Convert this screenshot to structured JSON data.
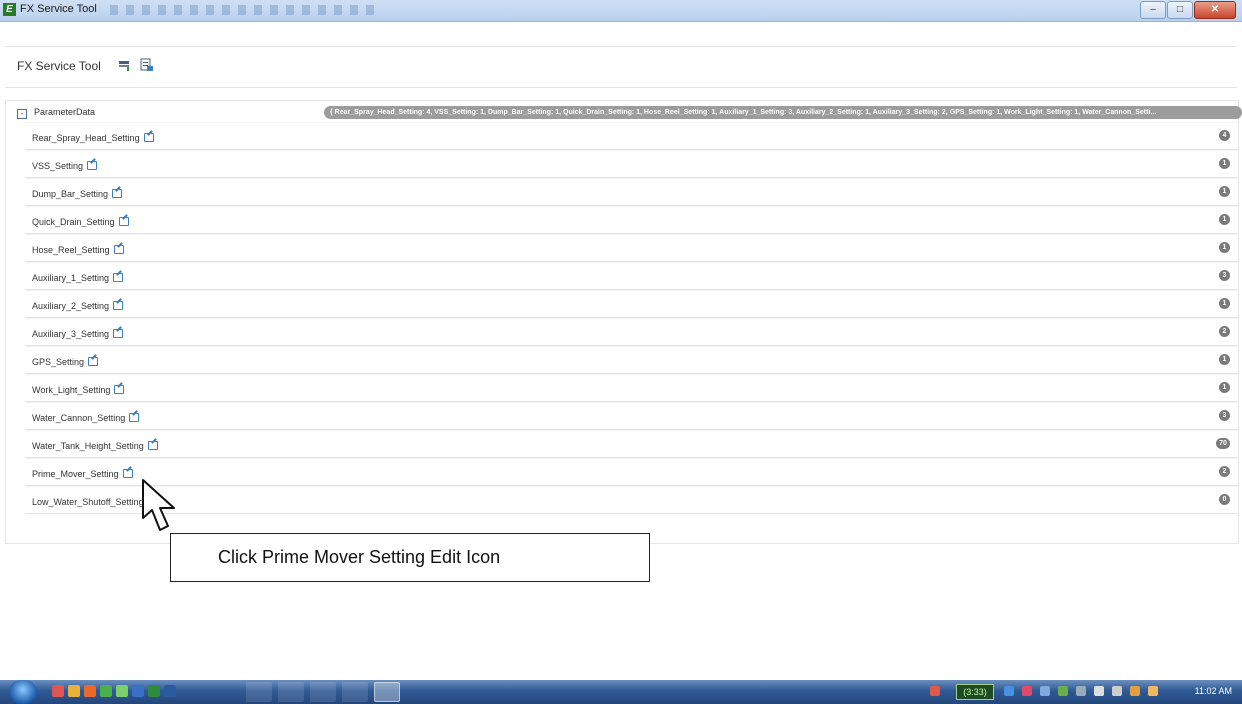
{
  "window": {
    "title": "FX Service Tool"
  },
  "header": {
    "title": "FX Service Tool",
    "icons": [
      "save-settings-icon",
      "load-settings-icon"
    ]
  },
  "tree": {
    "root_label": "ParameterData",
    "expander": "-",
    "summary": "{ Rear_Spray_Head_Setting: 4, VSS_Setting: 1, Dump_Bar_Setting: 1, Quick_Drain_Setting: 1, Hose_Reel_Setting: 1, Auxiliary_1_Setting: 3, Auxiliary_2_Setting: 1, Auxiliary_3_Setting: 2, GPS_Setting: 1, Work_Light_Setting: 1, Water_Cannon_Setti...",
    "items": [
      {
        "label": "Rear_Spray_Head_Setting",
        "value": "4"
      },
      {
        "label": "VSS_Setting",
        "value": "1"
      },
      {
        "label": "Dump_Bar_Setting",
        "value": "1"
      },
      {
        "label": "Quick_Drain_Setting",
        "value": "1"
      },
      {
        "label": "Hose_Reel_Setting",
        "value": "1"
      },
      {
        "label": "Auxiliary_1_Setting",
        "value": "3"
      },
      {
        "label": "Auxiliary_2_Setting",
        "value": "1"
      },
      {
        "label": "Auxiliary_3_Setting",
        "value": "2"
      },
      {
        "label": "GPS_Setting",
        "value": "1"
      },
      {
        "label": "Work_Light_Setting",
        "value": "1"
      },
      {
        "label": "Water_Cannon_Setting",
        "value": "3"
      },
      {
        "label": "Water_Tank_Height_Setting",
        "value": "70"
      },
      {
        "label": "Prime_Mover_Setting",
        "value": "2"
      },
      {
        "label": "Low_Water_Shutoff_Setting",
        "value": "0"
      }
    ]
  },
  "callout": {
    "text": "Click Prime Mover Setting Edit Icon"
  },
  "taskbar": {
    "battery": "(3:33)",
    "clock": "11:02 AM"
  },
  "colors": {
    "badge": "#7a7a7a",
    "edit_icon": "#3d7fc0",
    "taskbar": "#2f5a95"
  }
}
